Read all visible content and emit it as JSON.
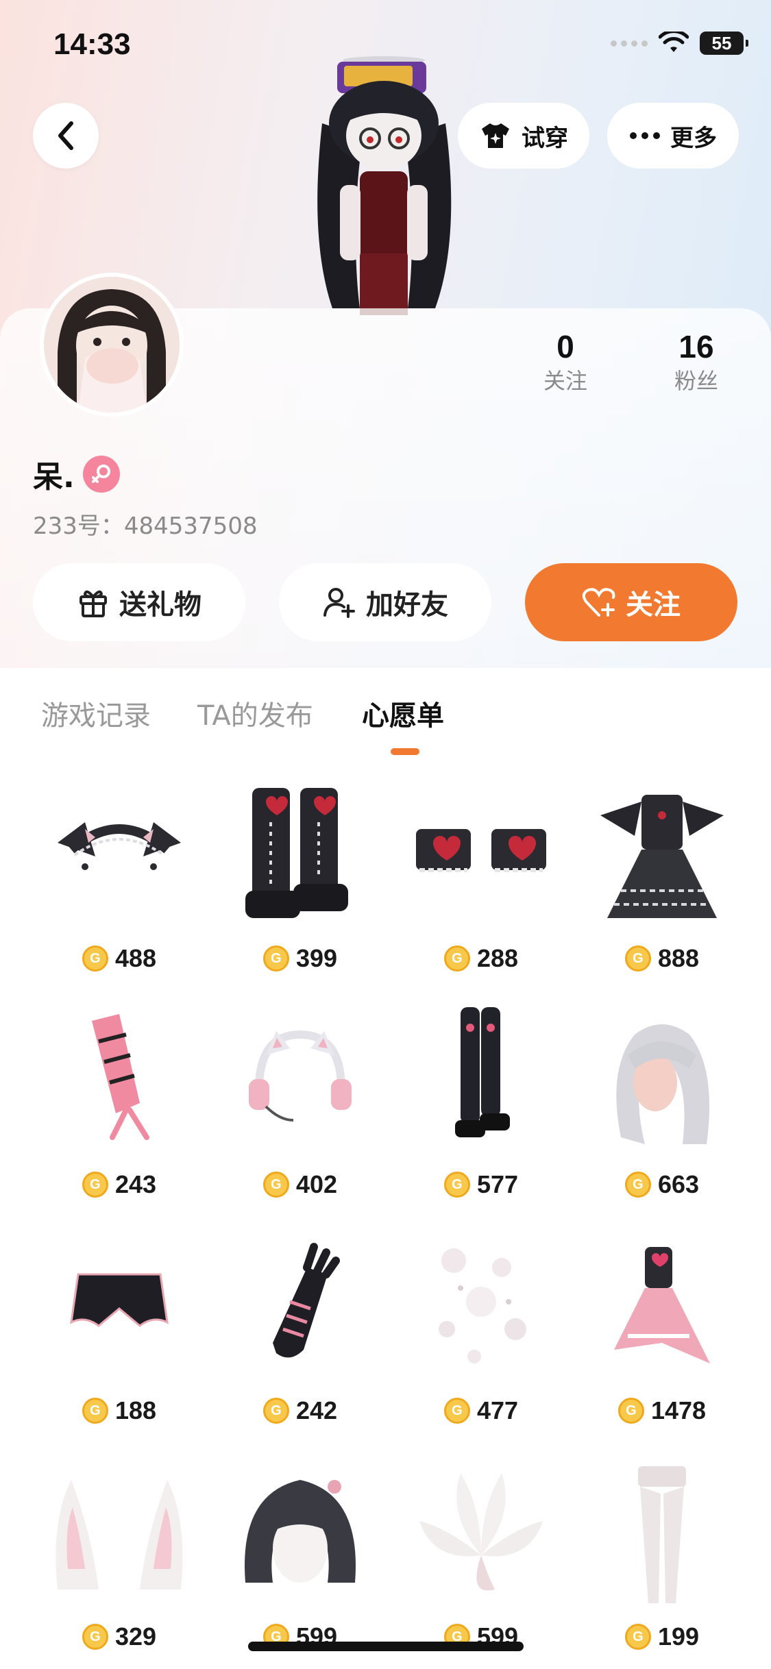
{
  "status_bar": {
    "time": "14:33",
    "battery": "55"
  },
  "header": {
    "try_on_label": "试穿",
    "more_label": "更多",
    "try_on_icon": "shirt-sparkle-icon",
    "more_icon": "ellipsis-icon",
    "back_icon": "chevron-left-icon"
  },
  "profile": {
    "nickname": "呆.",
    "gender": "female",
    "uid_text": "233号：484537508",
    "stats": [
      {
        "value": "0",
        "label": "关注"
      },
      {
        "value": "16",
        "label": "粉丝"
      }
    ]
  },
  "actions": {
    "gift_label": "送礼物",
    "add_friend_label": "加好友",
    "follow_label": "关注"
  },
  "colors": {
    "accent": "#f27a30",
    "coin": "#f8c84a",
    "gender_female": "#f5849d"
  },
  "tabs": [
    {
      "label": "游戏记录",
      "active": false
    },
    {
      "label": "TA的发布",
      "active": false
    },
    {
      "label": "心愿单",
      "active": true
    }
  ],
  "wishlist": [
    {
      "name": "cat-ear-headband",
      "price": "488"
    },
    {
      "name": "platform-boots",
      "price": "399"
    },
    {
      "name": "heart-bow-cuffs",
      "price": "288"
    },
    {
      "name": "gothic-dress",
      "price": "888"
    },
    {
      "name": "forever-sash",
      "price": "243"
    },
    {
      "name": "cat-ear-headphones",
      "price": "402"
    },
    {
      "name": "thigh-high-boots",
      "price": "577"
    },
    {
      "name": "silver-long-hair",
      "price": "663"
    },
    {
      "name": "black-shorts",
      "price": "188"
    },
    {
      "name": "lace-up-glove",
      "price": "242"
    },
    {
      "name": "sparkle-effect",
      "price": "477"
    },
    {
      "name": "pink-idol-dress",
      "price": "1478"
    },
    {
      "name": "white-fox-ears",
      "price": "329"
    },
    {
      "name": "black-bob-hair",
      "price": "599"
    },
    {
      "name": "white-fox-tails",
      "price": "599"
    },
    {
      "name": "white-tights",
      "price": "199"
    }
  ]
}
